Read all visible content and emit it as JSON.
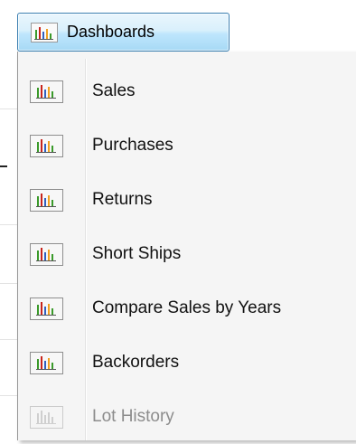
{
  "header_button": {
    "label": "Dashboards",
    "icon": "bar-chart-icon"
  },
  "menu": {
    "items": [
      {
        "label": "Sales",
        "icon": "bar-chart-icon",
        "enabled": true
      },
      {
        "label": "Purchases",
        "icon": "bar-chart-icon",
        "enabled": true
      },
      {
        "label": "Returns",
        "icon": "bar-chart-icon",
        "enabled": true
      },
      {
        "label": "Short Ships",
        "icon": "bar-chart-icon",
        "enabled": true
      },
      {
        "label": "Compare Sales by Years",
        "icon": "bar-chart-icon",
        "enabled": true
      },
      {
        "label": "Backorders",
        "icon": "bar-chart-icon",
        "enabled": true
      },
      {
        "label": "Lot History",
        "icon": "bar-chart-icon",
        "enabled": false
      }
    ]
  },
  "colors": {
    "bar_green": "#3a9a2a",
    "bar_red": "#c8241c",
    "bar_orange": "#f0a020",
    "bar_blue": "#3060c0",
    "disabled_text": "#8d8d8d"
  }
}
